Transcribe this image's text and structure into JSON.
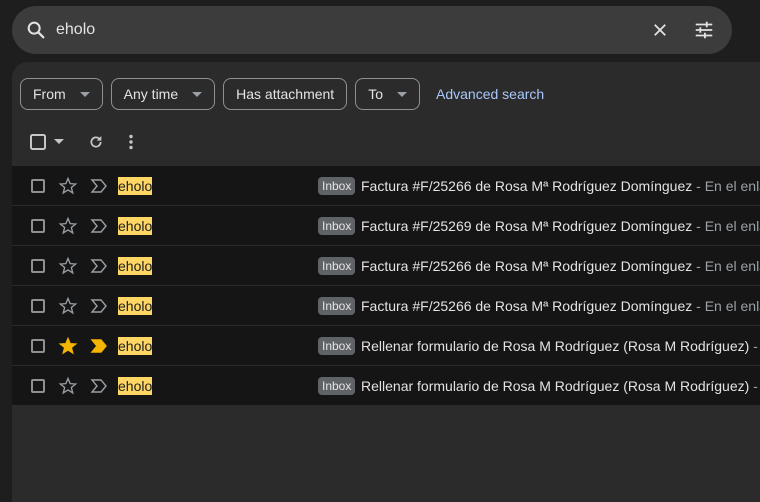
{
  "search": {
    "query": "eholo"
  },
  "filters": {
    "chips": [
      {
        "label": "From",
        "has_caret": true
      },
      {
        "label": "Any time",
        "has_caret": true
      },
      {
        "label": "Has attachment",
        "has_caret": false
      },
      {
        "label": "To",
        "has_caret": true
      }
    ],
    "advanced_search": "Advanced search"
  },
  "messages": [
    {
      "sender": "eholo",
      "label": "Inbox",
      "subject": "Factura #F/25266 de Rosa Mª Rodríguez Domínguez",
      "snippet": " - En el enla",
      "starred": false,
      "important": false
    },
    {
      "sender": "eholo",
      "label": "Inbox",
      "subject": "Factura #F/25269 de Rosa Mª Rodríguez Domínguez",
      "snippet": " - En el enla",
      "starred": false,
      "important": false
    },
    {
      "sender": "eholo",
      "label": "Inbox",
      "subject": "Factura #F/25266 de Rosa Mª Rodríguez Domínguez",
      "snippet": " - En el enla",
      "starred": false,
      "important": false
    },
    {
      "sender": "eholo",
      "label": "Inbox",
      "subject": "Factura #F/25266 de Rosa Mª Rodríguez Domínguez",
      "snippet": " - En el enla",
      "starred": false,
      "important": false
    },
    {
      "sender": "eholo",
      "label": "Inbox",
      "subject": "Rellenar formulario de Rosa M Rodríguez (Rosa M Rodríguez)",
      "snippet": " -",
      "starred": true,
      "important": true
    },
    {
      "sender": "eholo",
      "label": "Inbox",
      "subject": "Rellenar formulario de Rosa M Rodríguez (Rosa M Rodríguez)",
      "snippet": " -",
      "starred": false,
      "important": false
    }
  ],
  "colors": {
    "highlight": "#fdd663",
    "star_active": "#f4b400",
    "link": "#a8c7fa"
  }
}
